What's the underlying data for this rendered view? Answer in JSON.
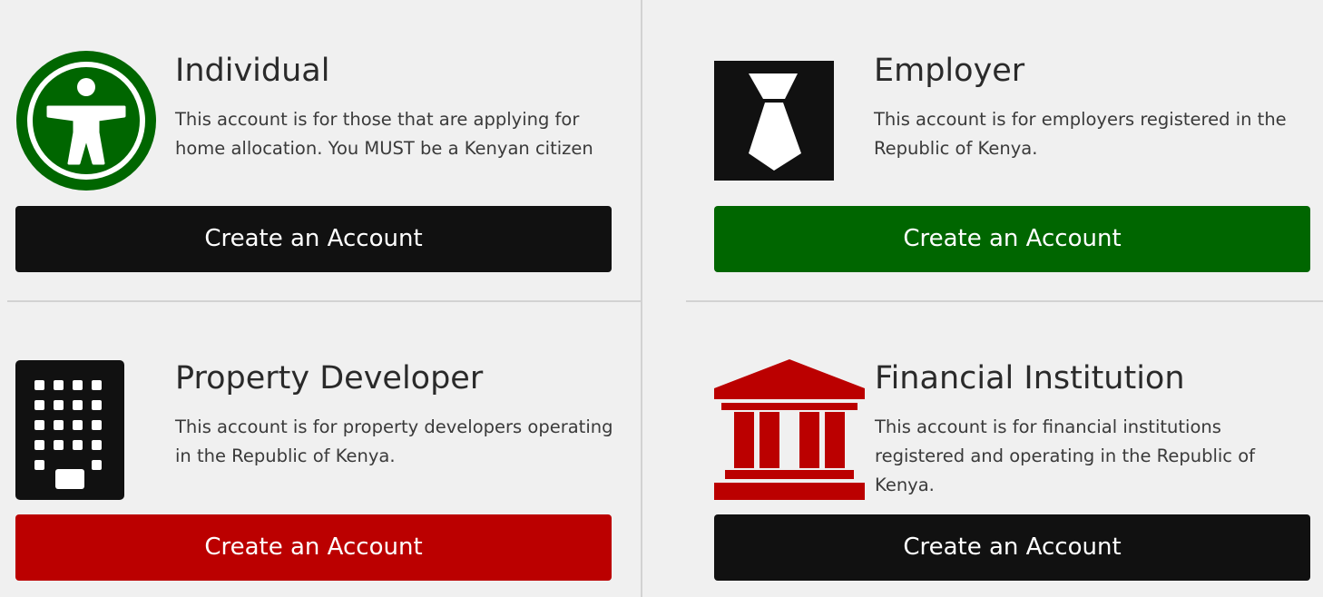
{
  "colors": {
    "green": "#006600",
    "red": "#bb0000",
    "black": "#111111",
    "background": "#f0f0f0"
  },
  "cards": {
    "individual": {
      "icon": "accessibility-person-icon",
      "title": "Individual",
      "description": "This account is for those that are applying for home allocation. You MUST be a Kenyan citizen",
      "button_label": "Create an Account"
    },
    "employer": {
      "icon": "necktie-icon",
      "title": "Employer",
      "description": "This account is for employers registered in the Republic of Kenya.",
      "button_label": "Create an Account"
    },
    "property_developer": {
      "icon": "building-icon",
      "title": "Property Developer",
      "description": "This account is for property developers operating in the Republic of Kenya.",
      "button_label": "Create an Account"
    },
    "financial_institution": {
      "icon": "bank-icon",
      "title": "Financial Institution",
      "description": "This account is for financial institutions registered and operating in the Republic of Kenya.",
      "button_label": "Create an Account"
    }
  }
}
